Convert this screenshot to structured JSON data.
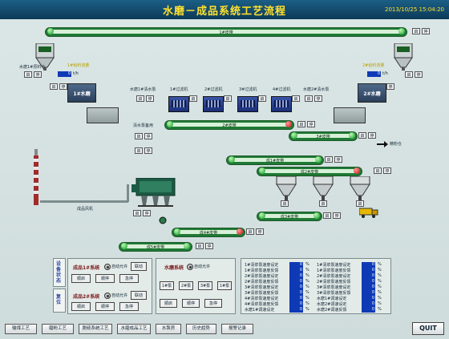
{
  "header": {
    "title": "水磨－成品系统工艺流程",
    "datetime": "2013/10/25 15:04:20"
  },
  "conveyors": {
    "c1": "1#皮带",
    "c2": "2#皮带",
    "c3": "3#皮带",
    "c4": "成1#皮带",
    "c5": "成2#皮带",
    "c6": "成3#皮带",
    "c7": "成4#皮带",
    "c8": "成5#皮带"
  },
  "labels": {
    "silo_left": "水磨1#原料仓",
    "silo_right": "2#原料仓",
    "feed_left": "1#给料流量",
    "feed_right": "2#给料流量",
    "pump_l1": "水磨1#清水泵",
    "pump_r1": "水磨2#清水泵",
    "filter1": "1#过滤机",
    "filter2": "2#过滤机",
    "filter3": "3#过滤机",
    "filter4": "4#过滤机",
    "pump_mid": "清水泵备用",
    "storage": "精粉仓",
    "fan": "成品风机",
    "mill1": "1#水磨",
    "mill2": "2#水磨"
  },
  "side_tabs": {
    "status": "设备状态",
    "reset": "复位"
  },
  "ctrl": {
    "sys1": "成品1#系统",
    "sys2": "成品2#系统",
    "auto": "自动允许",
    "link": "联动",
    "smooth": "顺启",
    "rev": "顺停",
    "emergency": "急停",
    "mill_sys": "水磨系统",
    "mill_auto": "自动允许",
    "p1": "1#泵",
    "p2": "2#泵",
    "p3": "3#泵",
    "p4": "1#泵"
  },
  "rates": [
    {
      "label": "1#清浆泵速度设定",
      "value": "0",
      "unit": "%"
    },
    {
      "label": "1#清浆泵速度反馈",
      "value": "0",
      "unit": "%"
    },
    {
      "label": "2#清浆泵速度设定",
      "value": "0",
      "unit": "%"
    },
    {
      "label": "2#清浆泵速度反馈",
      "value": "0",
      "unit": "%"
    },
    {
      "label": "3#清浆泵速度设定",
      "value": "0",
      "unit": "%"
    },
    {
      "label": "3#清浆泵速度反馈",
      "value": "0",
      "unit": "%"
    },
    {
      "label": "4#清浆泵速度设定",
      "value": "0",
      "unit": "%"
    },
    {
      "label": "4#清浆泵速度反馈",
      "value": "0",
      "unit": "%"
    },
    {
      "label": "水磨1#调速设定",
      "value": "0",
      "unit": "%"
    },
    {
      "label": "水磨1#调速反馈",
      "value": "0",
      "unit": "%"
    },
    {
      "label": "水磨2#调速设定",
      "value": "0",
      "unit": "%"
    },
    {
      "label": "水磨2#调速反馈",
      "value": "0",
      "unit": "%"
    }
  ],
  "rates_right": [
    {
      "label": "1#清浆泵速度设定",
      "value": "0",
      "unit": "%"
    },
    {
      "label": "1#清浆泵速度反馈",
      "value": "0",
      "unit": "%"
    },
    {
      "label": "2#清浆泵速度设定",
      "value": "0",
      "unit": "%"
    },
    {
      "label": "2#清浆泵速度反馈",
      "value": "0",
      "unit": "%"
    },
    {
      "label": "3#清浆泵速度设定",
      "value": "0",
      "unit": "%"
    },
    {
      "label": "3#清浆泵速度反馈",
      "value": "0",
      "unit": "%"
    },
    {
      "label": "水磨1#调速设定",
      "value": "0",
      "unit": "%"
    },
    {
      "label": "水磨2#调速设定",
      "value": "0",
      "unit": "%"
    },
    {
      "label": "水磨2#调速反馈",
      "value": "0",
      "unit": "%"
    }
  ],
  "nav": [
    "输煤工艺",
    "磨粉工艺",
    "脱硫系统工艺",
    "水磨成品工艺",
    "水泵房",
    "历史趋势",
    "报警记录"
  ],
  "quit": "QUIT",
  "btn": {
    "start": "启",
    "stop": "停"
  },
  "flow": {
    "left": "0",
    "right": "0",
    "unit": "t/h"
  }
}
